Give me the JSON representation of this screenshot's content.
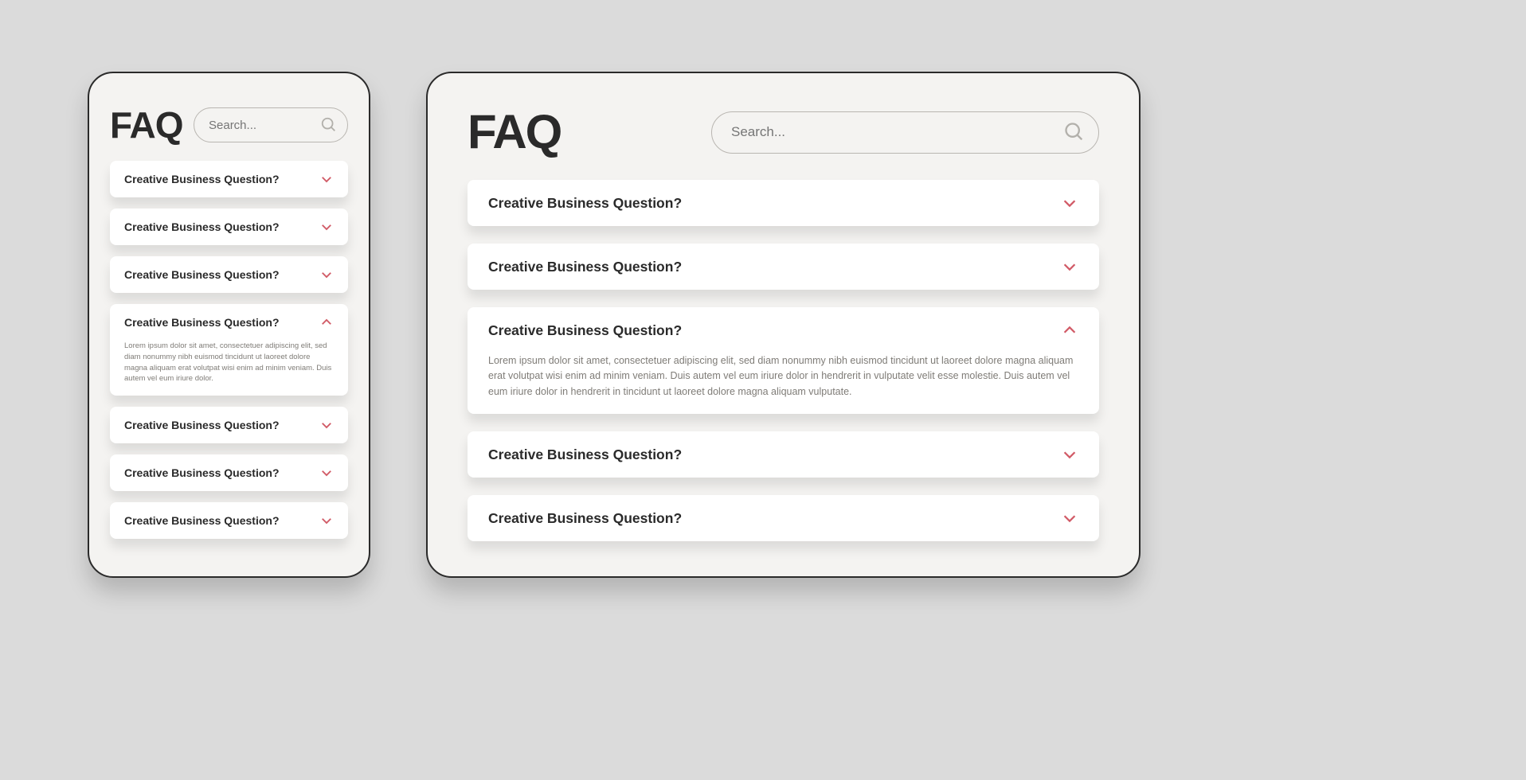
{
  "mobile": {
    "title": "FAQ",
    "search_placeholder": "Search...",
    "items": [
      {
        "question": "Creative Business Question?",
        "expanded": false,
        "answer": ""
      },
      {
        "question": "Creative Business Question?",
        "expanded": false,
        "answer": ""
      },
      {
        "question": "Creative Business Question?",
        "expanded": false,
        "answer": ""
      },
      {
        "question": "Creative Business Question?",
        "expanded": true,
        "answer": "Lorem ipsum dolor sit amet, consectetuer adipiscing elit, sed diam nonummy nibh euismod tincidunt ut laoreet dolore magna aliquam erat volutpat wisi enim ad minim veniam. Duis autem vel eum iriure dolor."
      },
      {
        "question": "Creative Business Question?",
        "expanded": false,
        "answer": ""
      },
      {
        "question": "Creative Business Question?",
        "expanded": false,
        "answer": ""
      },
      {
        "question": "Creative Business Question?",
        "expanded": false,
        "answer": ""
      }
    ]
  },
  "desktop": {
    "title": "FAQ",
    "search_placeholder": "Search...",
    "items": [
      {
        "question": "Creative Business Question?",
        "expanded": false,
        "answer": ""
      },
      {
        "question": "Creative Business Question?",
        "expanded": false,
        "answer": ""
      },
      {
        "question": "Creative Business Question?",
        "expanded": true,
        "answer": "Lorem ipsum dolor sit amet, consectetuer adipiscing elit, sed diam nonummy nibh euismod tincidunt ut laoreet dolore magna aliquam erat volutpat wisi enim ad minim veniam. Duis autem vel eum iriure dolor in hendrerit in vulputate velit esse molestie. Duis autem vel eum iriure dolor in hendrerit in tincidunt ut laoreet dolore magna aliquam vulputate."
      },
      {
        "question": "Creative Business Question?",
        "expanded": false,
        "answer": ""
      },
      {
        "question": "Creative Business Question?",
        "expanded": false,
        "answer": ""
      }
    ]
  },
  "colors": {
    "accent": "#d15a66"
  }
}
